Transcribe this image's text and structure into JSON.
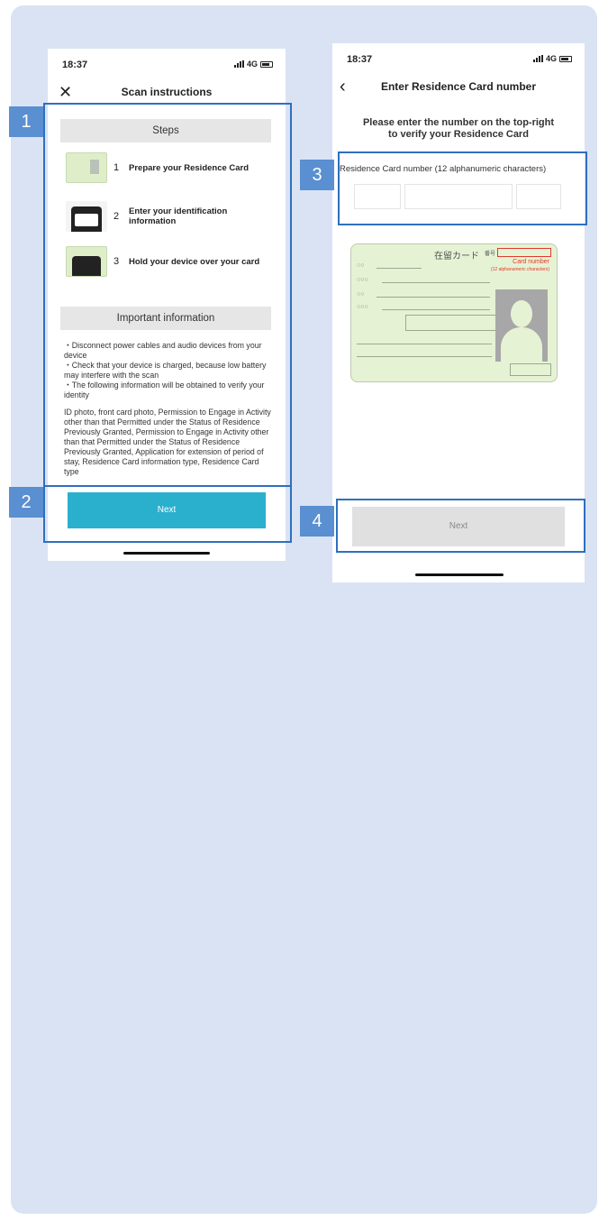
{
  "left_screen": {
    "status": {
      "time": "18:37",
      "network": "4G"
    },
    "title": "Scan instructions",
    "steps_header": "Steps",
    "steps": [
      {
        "num": "1",
        "label": "Prepare your Residence Card"
      },
      {
        "num": "2",
        "label": "Enter your identification information"
      },
      {
        "num": "3",
        "label": "Hold your device over your card"
      }
    ],
    "info_header": "Important information",
    "info_paragraphs": [
      "・Disconnect power cables and audio devices from your device",
      "・Check that your device is charged, because low battery may interfere with the scan",
      "・The following information will be obtained to verify your identity",
      "ID photo, front card photo, Permission to Engage in Activity other than that Permitted under the Status of Residence Previously Granted, Permission to Engage in Activity other than that Permitted under the Status of Residence Previously Granted, Application for extension of period of stay, Residence Card information type, Residence Card type"
    ],
    "next_label": "Next"
  },
  "right_screen": {
    "status": {
      "time": "18:37",
      "network": "4G"
    },
    "title": "Enter Residence Card number",
    "prompt_line1": "Please enter the number on the top-right",
    "prompt_line2": "to verify your Residence Card",
    "field_label": "Residence Card number (12 alphanumeric characters)",
    "card": {
      "title": "在留カード",
      "number_prefix": "番号",
      "number_label_line1": "Card number",
      "number_label_line2": "(12 alphanumeric characters)",
      "placeholder_circles": [
        "○○",
        "○○○",
        "○○",
        "○○○"
      ]
    },
    "next_label": "Next"
  },
  "callouts": [
    "1",
    "2",
    "3",
    "4"
  ],
  "colors": {
    "panel": "#dae3f3",
    "callout_frame": "#2f6fbf",
    "callout_badge": "#5a8fd1",
    "next_teal": "#2ab0cd",
    "next_disabled": "#e0e0e0",
    "card_green": "#e6f2d4",
    "card_number_red": "#e03a2d"
  },
  "icons": [
    "close-icon",
    "back-chevron-icon",
    "signal-icon",
    "battery-icon"
  ]
}
